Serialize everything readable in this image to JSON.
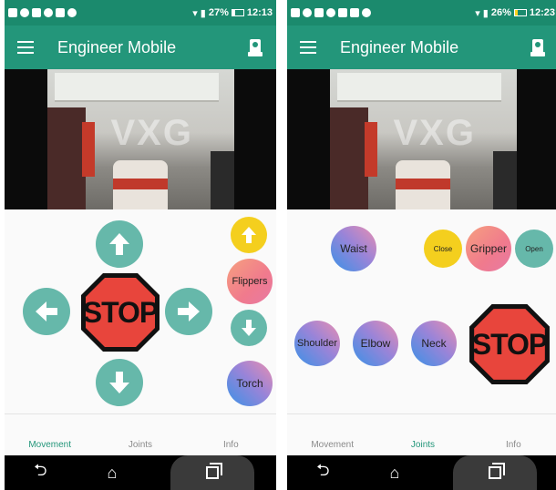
{
  "screens": [
    {
      "status": {
        "battery": "27%",
        "time": "12:13"
      },
      "app_title": "Engineer Mobile",
      "video_watermark": "VXG",
      "stop_label": "STOP",
      "flippers_label": "Flippers",
      "torch_label": "Torch",
      "nav": [
        "Movement",
        "Joints",
        "Info"
      ],
      "active_tab": "Movement"
    },
    {
      "status": {
        "battery": "26%",
        "time": "12:23"
      },
      "app_title": "Engineer Mobile",
      "video_watermark": "VXG",
      "stop_label": "STOP",
      "joints": {
        "waist": "Waist",
        "close": "Close",
        "gripper": "Gripper",
        "open": "Open",
        "shoulder": "Shoulder",
        "elbow": "Elbow",
        "neck": "Neck"
      },
      "nav": [
        "Movement",
        "Joints",
        "Info"
      ],
      "active_tab": "Joints"
    }
  ],
  "colors": {
    "status_bar": "#1b8a6d",
    "app_bar": "#23967a",
    "teal_button": "#66b8aa",
    "stop_red": "#e8453c",
    "yellow_button": "#f4cf1e"
  }
}
